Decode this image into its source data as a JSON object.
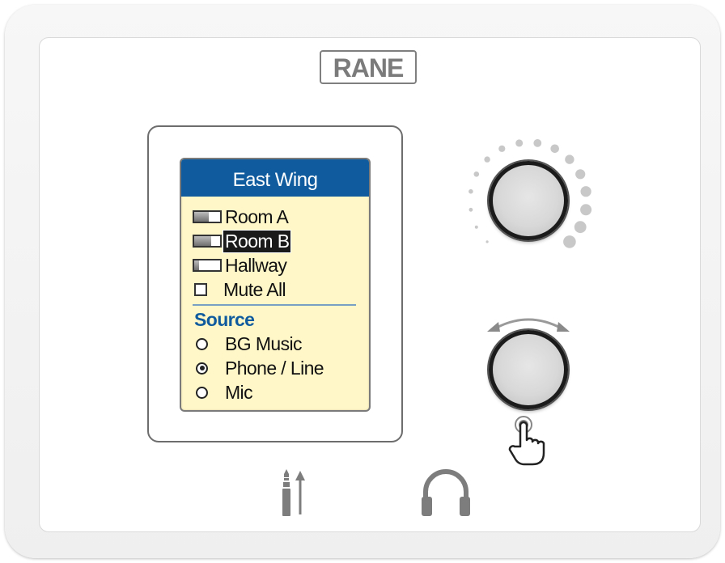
{
  "brand": {
    "logo_text": "RANE"
  },
  "display": {
    "zone_title": "East Wing",
    "zones": [
      {
        "label": "Room A",
        "level": 0.55,
        "selected": false
      },
      {
        "label": "Room B",
        "level": 0.65,
        "selected": true
      },
      {
        "label": "Hallway",
        "level": 0.18,
        "selected": false
      }
    ],
    "mute": {
      "label": "Mute All",
      "checked": false
    },
    "source": {
      "heading": "Source",
      "options": [
        {
          "label": "BG Music",
          "selected": false
        },
        {
          "label": "Phone / Line",
          "selected": true
        },
        {
          "label": "Mic",
          "selected": false
        }
      ]
    }
  },
  "controls": {
    "volume_knob_icon": "knob-with-level-ring",
    "select_knob_icon": "rotary-push-knob",
    "push_icon": "hand-press-icon"
  },
  "jacks": {
    "line_icon": "audio-jack-icon",
    "headphone_icon": "headphone-icon"
  },
  "colors": {
    "title_bar": "#0f5b9e",
    "screen_bg": "#fff7c8",
    "accent": "#0f5b9e"
  }
}
